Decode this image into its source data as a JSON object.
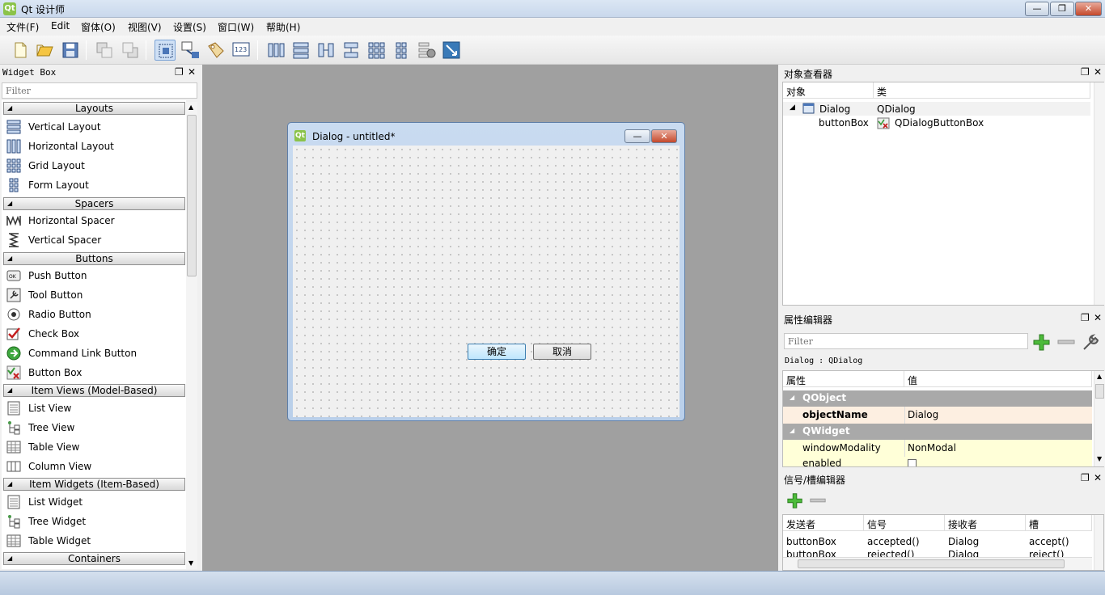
{
  "app": {
    "title": "Qt 设计师",
    "icon_letter": "Qt"
  },
  "window_buttons": {
    "minimize": "—",
    "restore": "❐",
    "close": "✕"
  },
  "menu": [
    "文件(F)",
    "Edit",
    "窗体(O)",
    "视图(V)",
    "设置(S)",
    "窗口(W)",
    "帮助(H)"
  ],
  "widget_box": {
    "title": "Widget Box",
    "filter_placeholder": "Filter",
    "categories": {
      "layouts": "Layouts",
      "spacers": "Spacers",
      "buttons": "Buttons",
      "item_views": "Item Views (Model-Based)",
      "item_widgets": "Item Widgets (Item-Based)",
      "containers": "Containers"
    },
    "items": {
      "vertical_layout": "Vertical Layout",
      "horizontal_layout": "Horizontal Layout",
      "grid_layout": "Grid Layout",
      "form_layout": "Form Layout",
      "horizontal_spacer": "Horizontal Spacer",
      "vertical_spacer": "Vertical Spacer",
      "push_button": "Push Button",
      "tool_button": "Tool Button",
      "radio_button": "Radio Button",
      "check_box": "Check Box",
      "command_link_button": "Command Link Button",
      "button_box": "Button Box",
      "list_view": "List View",
      "tree_view": "Tree View",
      "table_view": "Table View",
      "column_view": "Column View",
      "list_widget": "List Widget",
      "tree_widget": "Tree Widget",
      "table_widget": "Table Widget"
    }
  },
  "dialog": {
    "title": "Dialog - untitled*",
    "ok": "确定",
    "cancel": "取消"
  },
  "object_inspector": {
    "title": "对象查看器",
    "col_object": "对象",
    "col_class": "类",
    "rows": [
      {
        "object": "Dialog",
        "class": "QDialog"
      },
      {
        "object": "buttonBox",
        "class": "QDialogButtonBox"
      }
    ]
  },
  "property_editor": {
    "title": "属性编辑器",
    "filter_placeholder": "Filter",
    "context": "Dialog : QDialog",
    "col_property": "属性",
    "col_value": "值",
    "group_qobject": "QObject",
    "object_name_label": "objectName",
    "object_name_value": "Dialog",
    "group_qwidget": "QWidget",
    "window_modality_label": "windowModality",
    "window_modality_value": "NonModal",
    "enabled_label": "enabled"
  },
  "signal_slot": {
    "title": "信号/槽编辑器",
    "col_sender": "发送者",
    "col_signal": "信号",
    "col_receiver": "接收者",
    "col_slot": "槽",
    "rows": [
      {
        "sender": "buttonBox",
        "signal": "accepted()",
        "receiver": "Dialog",
        "slot": "accept()"
      },
      {
        "sender": "buttonBox",
        "signal": "rejected()",
        "receiver": "Dialog",
        "slot": "reject()"
      }
    ]
  },
  "colors": {
    "accent": "#3c7fb1",
    "group_header": "#a9a9a9",
    "selected_row": "#fdefe1"
  }
}
